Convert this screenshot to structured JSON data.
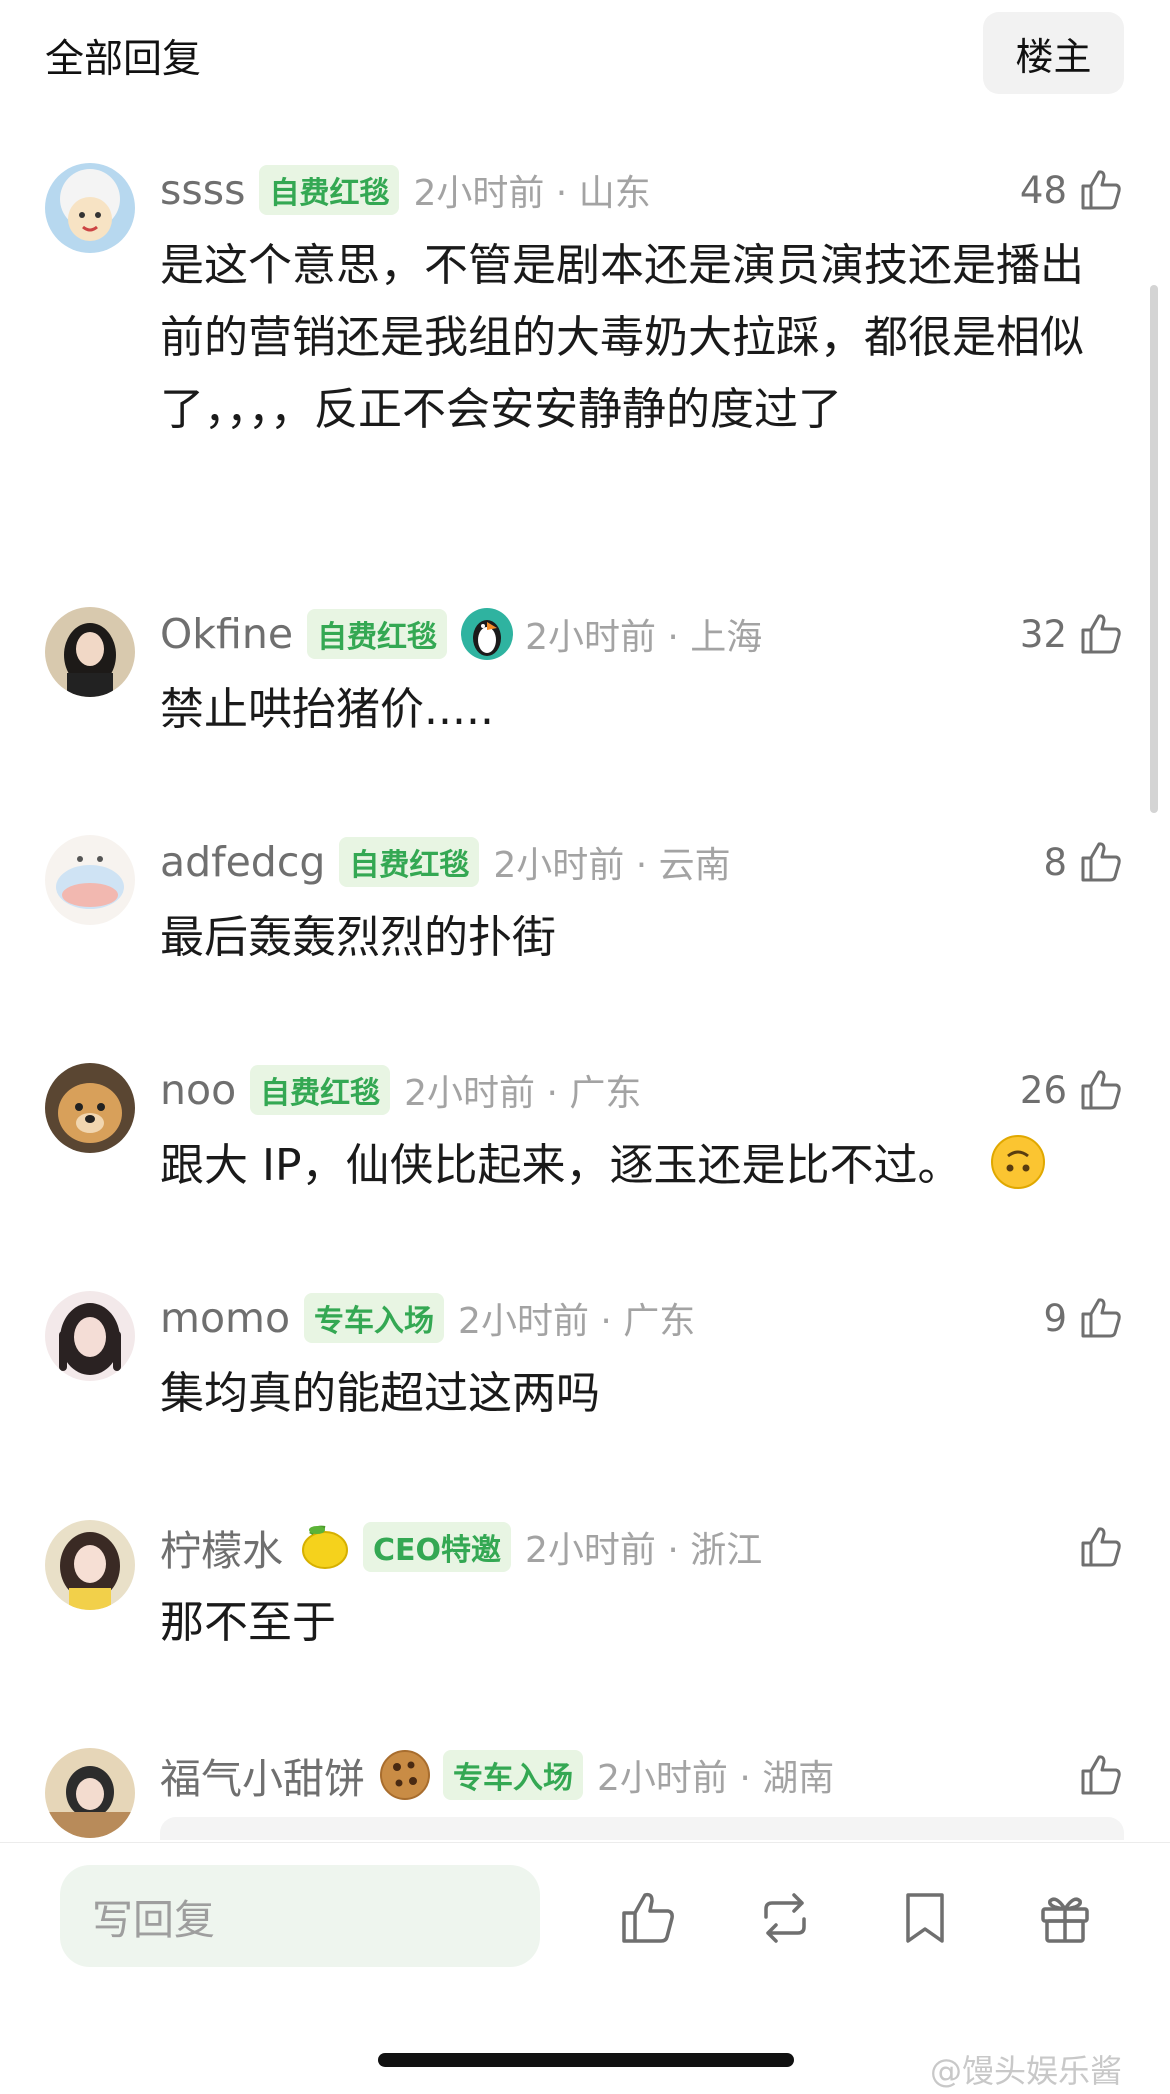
{
  "header": {
    "title": "全部回复",
    "op_button": "楼主"
  },
  "comments": [
    {
      "username": "ssss",
      "badge": "自费红毯",
      "time_location": "2小时前 · 山东",
      "likes": "48",
      "text": "是这个意思，不管是剧本还是演员演技还是播出前的营销还是我组的大毒奶大拉踩，都很是相似了，，，，反正不会安安静静的度过了"
    },
    {
      "username": "Okfine",
      "badge": "自费红毯",
      "time_location": "2小时前 · 上海",
      "likes": "32",
      "text": "禁止哄抬猪价....."
    },
    {
      "username": "adfedcg",
      "badge": "自费红毯",
      "time_location": "2小时前 · 云南",
      "likes": "8",
      "text": "最后轰轰烈烈的扑街"
    },
    {
      "username": "noo",
      "badge": "自费红毯",
      "time_location": "2小时前 · 广东",
      "likes": "26",
      "text": "跟大 IP，仙侠比起来，逐玉还是比不过。"
    },
    {
      "username": "momo",
      "badge": "专车入场",
      "time_location": "2小时前 · 广东",
      "likes": "9",
      "text": "集均真的能超过这两吗"
    },
    {
      "username": "柠檬水",
      "badge": "CEO特邀",
      "time_location": "2小时前 · 浙江",
      "likes": "",
      "text": "那不至于"
    },
    {
      "username": "福气小甜饼",
      "badge": "专车入场",
      "time_location": "2小时前 · 湖南",
      "likes": "",
      "text": ""
    }
  ],
  "reply_bar": {
    "placeholder": "写回复"
  },
  "watermark": "@馒头娱乐酱",
  "colors": {
    "badge_green": "#34a853",
    "badge_bg": "#e8f5e3",
    "meta_gray": "#a3a3a3"
  }
}
